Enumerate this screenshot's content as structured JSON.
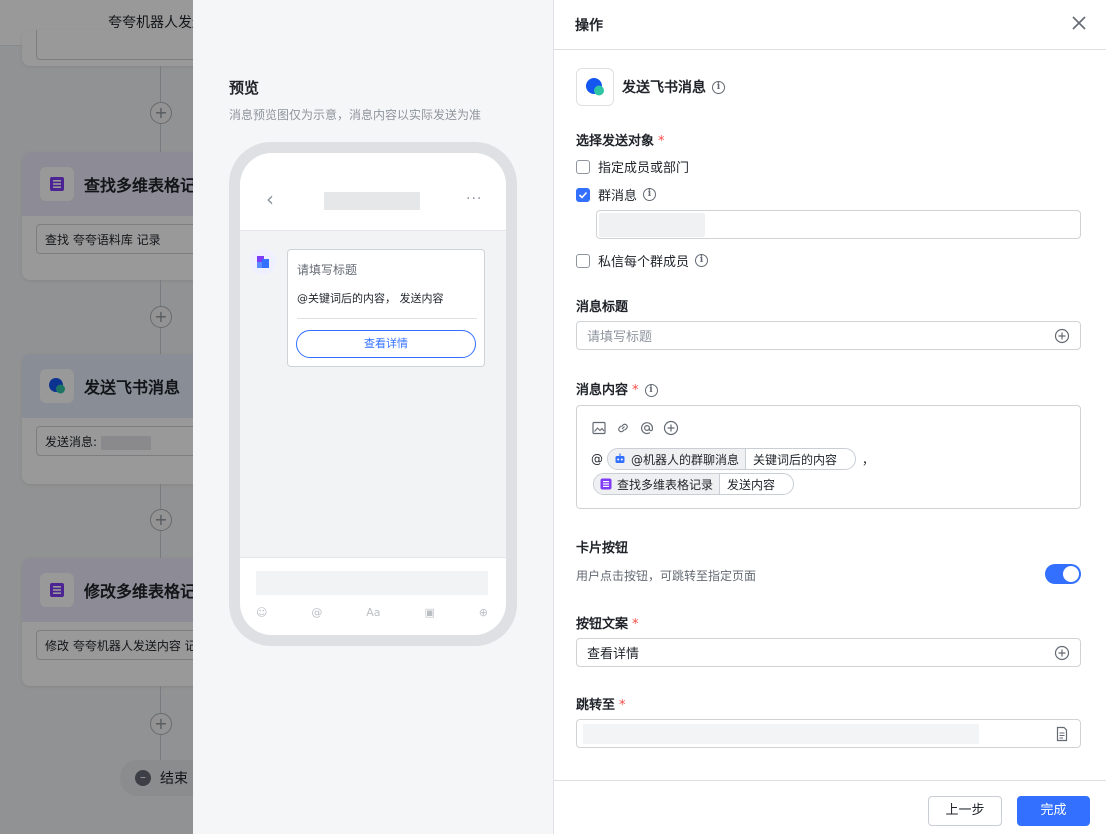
{
  "canvas": {
    "title": "夸夸机器人发送内容",
    "cards": [
      {
        "title": "查找多维表格记录",
        "field": "查找 夸夸语料库 记录",
        "kind": "bitable"
      },
      {
        "title": "发送飞书消息",
        "field": "发送消息:",
        "kind": "lark"
      },
      {
        "title": "修改多维表格记录",
        "field": "修改 夸夸机器人发送内容 记录",
        "kind": "bitable"
      }
    ],
    "end_label": "结束"
  },
  "preview": {
    "title": "预览",
    "description": "消息预览图仅为示意，消息内容以实际发送为准",
    "card_title": "请填写标题",
    "card_content": "@关键词后的内容， 发送内容",
    "card_button": "查看详情",
    "bottom_tools": [
      "☺",
      "@",
      "Aa",
      "▣",
      "⊕"
    ]
  },
  "panel": {
    "header": "操作",
    "action_name": "发送飞书消息",
    "recipient": {
      "label": "选择发送对象",
      "options": [
        {
          "label": "指定成员或部门",
          "checked": false,
          "info": false
        },
        {
          "label": "群消息",
          "checked": true,
          "info": true
        },
        {
          "label": "私信每个群成员",
          "checked": false,
          "info": true
        }
      ]
    },
    "message_title": {
      "label": "消息标题",
      "placeholder": "请填写标题"
    },
    "message_content": {
      "label": "消息内容",
      "prefix": "@",
      "chip1_source": "@机器人的群聊消息",
      "chip1_field": "关键词后的内容",
      "separator": "，",
      "chip2_source": "查找多维表格记录",
      "chip2_field": "发送内容"
    },
    "card_button": {
      "label": "卡片按钮",
      "description": "用户点击按钮，可跳转至指定页面",
      "enabled": true
    },
    "button_text": {
      "label": "按钮文案",
      "value": "查看详情"
    },
    "jump_to": {
      "label": "跳转至"
    },
    "footer": {
      "prev": "上一步",
      "done": "完成"
    }
  },
  "colors": {
    "accent": "#3370ff",
    "required": "#f54a45",
    "bitable": "#7f3bf5"
  }
}
